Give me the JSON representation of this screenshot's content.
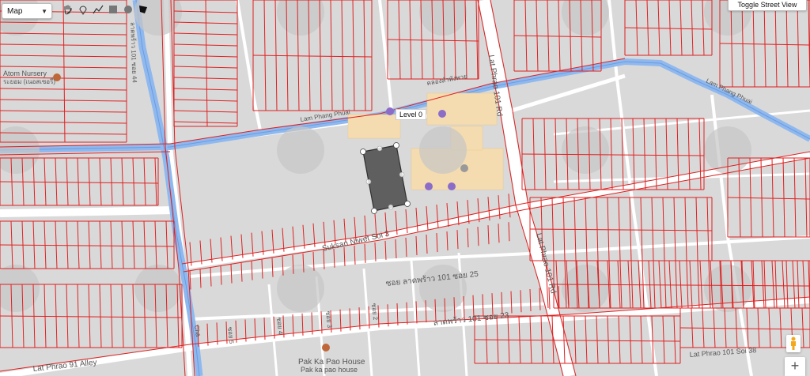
{
  "map_type_select": {
    "value": "Map"
  },
  "toolbar": {
    "tools": [
      {
        "name": "pan-hand-icon"
      },
      {
        "name": "marker-icon"
      },
      {
        "name": "polyline-icon"
      },
      {
        "name": "rectangle-icon"
      },
      {
        "name": "circle-icon"
      },
      {
        "name": "polygon-icon"
      }
    ]
  },
  "street_view_button": {
    "label": "Toggle Street View"
  },
  "zoom": {
    "in_label": "+"
  },
  "indoor": {
    "level_label": "Level 0"
  },
  "labels": {
    "atom_nursery_en": "Atom Nursery",
    "atom_nursery_th": "ระยอม (เนอสเซอรี่)",
    "lam_phang_phuai_1": "Lam Phang Phuai",
    "lam_phang_phuai_2": "Lam Phang Phuai",
    "lam_phang_phuai_th": "คลองลำพังพวย",
    "lat_phrao_101_rd_1": "Lat Phrao 101 Rd",
    "lat_phrao_101_rd_2": "Lat Phrao 101 Rd",
    "suksan_niwet_soi_3": "Suksan Niwet Soi 3",
    "soi_25_th": "ซอย ลาดพร้าว 101 ซอย 25",
    "soi_23_th": "ลาดพร้าว 101 ซอย 23",
    "lat_phrao_91_alley": "Lat Phrao 91 Alley",
    "pak_ka_pao_1": "Pak Ka Pao House",
    "pak_ka_pao_2": "Pak ka pao house",
    "lat_phrao_101_soi_38": "Lat Phrao 101 Soi 38",
    "soi_44_th": "ลาดพร้าว 101 ซอย 44",
    "soi_5": "ซอย 5",
    "soi_4": "ซอย 4",
    "soi_3": "ซอย 3",
    "soi_2": "ซอย 2",
    "chan": "Chā"
  },
  "colors": {
    "parcel_line": "#e02020",
    "canal": "#8fb8ee",
    "road": "#ffffff",
    "background": "#d9d9d9",
    "polygon_fill": "#555555",
    "building": "#f5dcb0"
  }
}
